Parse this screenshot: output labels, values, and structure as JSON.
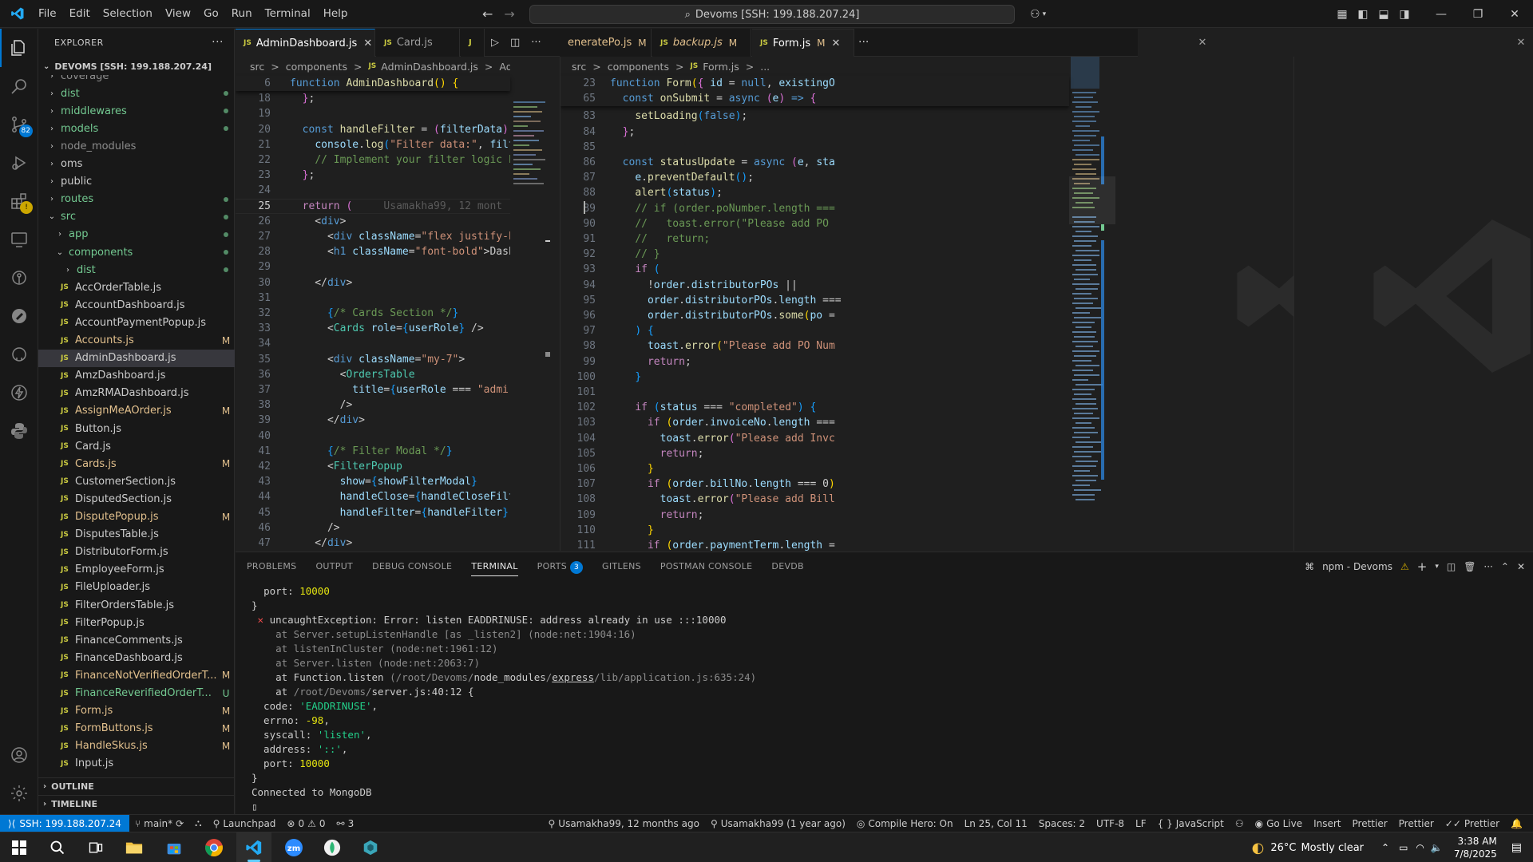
{
  "menu": [
    "File",
    "Edit",
    "Selection",
    "View",
    "Go",
    "Run",
    "Terminal",
    "Help"
  ],
  "command_center": "Devoms [SSH: 199.188.207.24]",
  "explorer": {
    "title": "EXPLORER",
    "workspace": "DEVOMS [SSH: 199.188.207.24]",
    "items": [
      {
        "name": "coverage",
        "kind": "folder",
        "depth": 1,
        "status": "",
        "color": "dim"
      },
      {
        "name": "dist",
        "kind": "folder",
        "depth": 1,
        "status": "dot",
        "color": "git"
      },
      {
        "name": "middlewares",
        "kind": "folder",
        "depth": 1,
        "status": "dot",
        "color": "git"
      },
      {
        "name": "models",
        "kind": "folder",
        "depth": 1,
        "status": "dot",
        "color": "git"
      },
      {
        "name": "node_modules",
        "kind": "folder",
        "depth": 1,
        "status": "",
        "color": "dim"
      },
      {
        "name": "oms",
        "kind": "folder",
        "depth": 1,
        "status": "",
        "color": "norm"
      },
      {
        "name": "public",
        "kind": "folder",
        "depth": 1,
        "status": "",
        "color": "norm"
      },
      {
        "name": "routes",
        "kind": "folder",
        "depth": 1,
        "status": "dot",
        "color": "git"
      },
      {
        "name": "src",
        "kind": "folder-open",
        "depth": 1,
        "status": "dot",
        "color": "git"
      },
      {
        "name": "app",
        "kind": "folder",
        "depth": 2,
        "status": "dot",
        "color": "git"
      },
      {
        "name": "components",
        "kind": "folder-open",
        "depth": 2,
        "status": "dot",
        "color": "git"
      },
      {
        "name": "dist",
        "kind": "folder",
        "depth": 3,
        "status": "dot",
        "color": "git"
      },
      {
        "name": "AccOrderTable.js",
        "kind": "js",
        "depth": 3,
        "status": "",
        "color": "norm"
      },
      {
        "name": "AccountDashboard.js",
        "kind": "js",
        "depth": 3,
        "status": "",
        "color": "norm"
      },
      {
        "name": "AccountPaymentPopup.js",
        "kind": "js",
        "depth": 3,
        "status": "",
        "color": "norm"
      },
      {
        "name": "Accounts.js",
        "kind": "js",
        "depth": 3,
        "status": "M",
        "color": "mod"
      },
      {
        "name": "AdminDashboard.js",
        "kind": "js",
        "depth": 3,
        "status": "",
        "color": "norm",
        "selected": true
      },
      {
        "name": "AmzDashboard.js",
        "kind": "js",
        "depth": 3,
        "status": "",
        "color": "norm"
      },
      {
        "name": "AmzRMADashboard.js",
        "kind": "js",
        "depth": 3,
        "status": "",
        "color": "norm"
      },
      {
        "name": "AssignMeAOrder.js",
        "kind": "js",
        "depth": 3,
        "status": "M",
        "color": "mod"
      },
      {
        "name": "Button.js",
        "kind": "js",
        "depth": 3,
        "status": "",
        "color": "norm"
      },
      {
        "name": "Card.js",
        "kind": "js",
        "depth": 3,
        "status": "",
        "color": "norm"
      },
      {
        "name": "Cards.js",
        "kind": "js",
        "depth": 3,
        "status": "M",
        "color": "mod"
      },
      {
        "name": "CustomerSection.js",
        "kind": "js",
        "depth": 3,
        "status": "",
        "color": "norm"
      },
      {
        "name": "DisputedSection.js",
        "kind": "js",
        "depth": 3,
        "status": "",
        "color": "norm"
      },
      {
        "name": "DisputePopup.js",
        "kind": "js",
        "depth": 3,
        "status": "M",
        "color": "mod"
      },
      {
        "name": "DisputesTable.js",
        "kind": "js",
        "depth": 3,
        "status": "",
        "color": "norm"
      },
      {
        "name": "DistributorForm.js",
        "kind": "js",
        "depth": 3,
        "status": "",
        "color": "norm"
      },
      {
        "name": "EmployeeForm.js",
        "kind": "js",
        "depth": 3,
        "status": "",
        "color": "norm"
      },
      {
        "name": "FileUploader.js",
        "kind": "js",
        "depth": 3,
        "status": "",
        "color": "norm"
      },
      {
        "name": "FilterOrdersTable.js",
        "kind": "js",
        "depth": 3,
        "status": "",
        "color": "norm"
      },
      {
        "name": "FilterPopup.js",
        "kind": "js",
        "depth": 3,
        "status": "",
        "color": "norm"
      },
      {
        "name": "FinanceComments.js",
        "kind": "js",
        "depth": 3,
        "status": "",
        "color": "norm"
      },
      {
        "name": "FinanceDashboard.js",
        "kind": "js",
        "depth": 3,
        "status": "",
        "color": "norm"
      },
      {
        "name": "FinanceNotVerifiedOrderT...",
        "kind": "js",
        "depth": 3,
        "status": "M",
        "color": "mod"
      },
      {
        "name": "FinanceReverifiedOrderTab...",
        "kind": "js",
        "depth": 3,
        "status": "U",
        "color": "unt"
      },
      {
        "name": "Form.js",
        "kind": "js",
        "depth": 3,
        "status": "M",
        "color": "mod"
      },
      {
        "name": "FormButtons.js",
        "kind": "js",
        "depth": 3,
        "status": "M",
        "color": "mod"
      },
      {
        "name": "HandleSkus.js",
        "kind": "js",
        "depth": 3,
        "status": "M",
        "color": "mod"
      },
      {
        "name": "Input.js",
        "kind": "js",
        "depth": 3,
        "status": "",
        "color": "norm"
      }
    ],
    "outline": "OUTLINE",
    "timeline": "TIMELINE"
  },
  "tabs_left": [
    {
      "name": "AdminDashboard.js",
      "active": true,
      "flag": "",
      "close": "✕"
    },
    {
      "name": "Card.js",
      "active": false,
      "flag": "",
      "close": ""
    },
    {
      "name": "J",
      "active": false,
      "flag": "",
      "close": ""
    }
  ],
  "tabs_right": [
    {
      "name": "eneratePo.js",
      "flag": "M",
      "italic": false
    },
    {
      "name": "backup.js",
      "flag": "M",
      "italic": true
    },
    {
      "name": "Form.js",
      "flag": "M",
      "italic": false,
      "close": "✕"
    }
  ],
  "left_pane": {
    "crumbs": [
      "src",
      ">",
      "components",
      ">",
      "JS",
      "AdminDashboard.js",
      ">",
      "AdminDashboarc"
    ],
    "sticky_ln": "6",
    "lines": [
      {
        "n": "18",
        "html": "  <span class='brc2'>}</span>;"
      },
      {
        "n": "19",
        "html": ""
      },
      {
        "n": "20",
        "html": "  <span class='kw'>const</span> <span class='fn'>handleFilter</span> = <span class='brc2'>(</span><span class='var'>filterData</span><span class='brc2'>)</span>"
      },
      {
        "n": "21",
        "html": "    <span class='var'>console</span>.<span class='fn'>log</span><span class='brc3'>(</span><span class='str'>\"Filter data:\"</span>, <span class='var'>filt</span>"
      },
      {
        "n": "22",
        "html": "    <span class='cm'>// Implement your filter logic h</span>"
      },
      {
        "n": "23",
        "html": "  <span class='brc2'>}</span>;"
      },
      {
        "n": "24",
        "html": ""
      },
      {
        "n": "25",
        "html": "  <span class='kw2'>return</span> <span class='brc2'>(</span>     <span class='blame'>Usamakha99, 12 mont</span>",
        "cur": true
      },
      {
        "n": "26",
        "html": "    &lt;<span class='tag'>div</span>&gt;"
      },
      {
        "n": "27",
        "html": "      &lt;<span class='tag'>div</span> <span class='attr'>className</span>=<span class='str'>\"flex justify-b</span>"
      },
      {
        "n": "28",
        "html": "      &lt;<span class='tag'>h1</span> <span class='attr'>className</span>=<span class='str'>\"font-bold\"</span>&gt;Dash"
      },
      {
        "n": "29",
        "html": ""
      },
      {
        "n": "30",
        "html": "    &lt;/<span class='tag'>div</span>&gt;"
      },
      {
        "n": "31",
        "html": ""
      },
      {
        "n": "32",
        "html": "      <span class='brc3'>{</span><span class='cm'>/* Cards Section */</span><span class='brc3'>}</span>"
      },
      {
        "n": "33",
        "html": "      &lt;<span class='cmp'>Cards</span> <span class='attr'>role</span>=<span class='brc3'>{</span><span class='var'>userRole</span><span class='brc3'>}</span> /&gt;"
      },
      {
        "n": "34",
        "html": ""
      },
      {
        "n": "35",
        "html": "      &lt;<span class='tag'>div</span> <span class='attr'>className</span>=<span class='str'>\"my-7\"</span>&gt;"
      },
      {
        "n": "36",
        "html": "        &lt;<span class='cmp'>OrdersTable</span>"
      },
      {
        "n": "37",
        "html": "          <span class='attr'>title</span>=<span class='brc3'>{</span><span class='var'>userRole</span> === <span class='str'>\"admir</span>"
      },
      {
        "n": "38",
        "html": "        /&gt;"
      },
      {
        "n": "39",
        "html": "      &lt;/<span class='tag'>div</span>&gt;"
      },
      {
        "n": "40",
        "html": ""
      },
      {
        "n": "41",
        "html": "      <span class='brc3'>{</span><span class='cm'>/* Filter Modal */</span><span class='brc3'>}</span>"
      },
      {
        "n": "42",
        "html": "      &lt;<span class='cmp'>FilterPopup</span>"
      },
      {
        "n": "43",
        "html": "        <span class='attr'>show</span>=<span class='brc3'>{</span><span class='var'>showFilterModal</span><span class='brc3'>}</span>"
      },
      {
        "n": "44",
        "html": "        <span class='attr'>handleClose</span>=<span class='brc3'>{</span><span class='var'>handleCloseFilt</span>"
      },
      {
        "n": "45",
        "html": "        <span class='attr'>handleFilter</span>=<span class='brc3'>{</span><span class='var'>handleFilter</span><span class='brc3'>}</span>"
      },
      {
        "n": "46",
        "html": "      /&gt;"
      },
      {
        "n": "47",
        "html": "    &lt;/<span class='tag'>div</span>&gt;"
      }
    ]
  },
  "right_pane": {
    "crumbs": [
      "src",
      ">",
      "components",
      ">",
      "JS",
      "Form.js",
      ">",
      "..."
    ],
    "sticky": [
      {
        "n": "23",
        "html": "<span class='kw'>function</span> <span class='fn'>Form</span><span class='brc'>(</span><span class='brc2'>{</span> <span class='var'>id</span> = <span class='kw'>null</span>, <span class='var'>existingO</span>"
      },
      {
        "n": "65",
        "html": "  <span class='kw'>const</span> <span class='fn'>onSubmit</span> = <span class='kw'>async</span> <span class='brc2'>(</span><span class='var'>e</span><span class='brc2'>)</span> <span class='kw'>=&gt;</span> <span class='brc2'>{</span>"
      }
    ],
    "lines": [
      {
        "n": "83",
        "html": "    <span class='fn'>setLoading</span><span class='brc3'>(</span><span class='kw'>false</span><span class='brc3'>)</span>;"
      },
      {
        "n": "84",
        "html": "  <span class='brc2'>}</span>;"
      },
      {
        "n": "85",
        "html": ""
      },
      {
        "n": "86",
        "html": "  <span class='kw'>const</span> <span class='fn'>statusUpdate</span> = <span class='kw'>async</span> <span class='brc2'>(</span><span class='var'>e</span>, <span class='var'>sta</span>"
      },
      {
        "n": "87",
        "html": "    <span class='var'>e</span>.<span class='fn'>preventDefault</span><span class='brc3'>()</span>;"
      },
      {
        "n": "88",
        "html": "    <span class='fn'>alert</span><span class='brc3'>(</span><span class='var'>status</span><span class='brc3'>)</span>;"
      },
      {
        "n": "89",
        "html": "    <span class='cm'>// if (order.poNumber.length ===</span>"
      },
      {
        "n": "90",
        "html": "    <span class='cm'>//   toast.error(\"Please add PO</span>"
      },
      {
        "n": "91",
        "html": "    <span class='cm'>//   return;</span>"
      },
      {
        "n": "92",
        "html": "    <span class='cm'>// }</span>"
      },
      {
        "n": "93",
        "html": "    <span class='kw2'>if</span> <span class='brc3'>(</span>"
      },
      {
        "n": "94",
        "html": "      !<span class='var'>order</span>.<span class='var'>distributorPOs</span> ||"
      },
      {
        "n": "95",
        "html": "      <span class='var'>order</span>.<span class='var'>distributorPOs</span>.<span class='var'>length</span> ==="
      },
      {
        "n": "96",
        "html": "      <span class='var'>order</span>.<span class='var'>distributorPOs</span>.<span class='fn'>some</span><span class='brc'>(</span><span class='var'>po</span> ="
      },
      {
        "n": "97",
        "html": "    <span class='brc3'>)</span> <span class='brc3'>{</span>"
      },
      {
        "n": "98",
        "html": "      <span class='var'>toast</span>.<span class='fn'>error</span><span class='brc'>(</span><span class='str'>\"Please add PO Num</span>"
      },
      {
        "n": "99",
        "html": "      <span class='kw2'>return</span>;"
      },
      {
        "n": "100",
        "html": "    <span class='brc3'>}</span>"
      },
      {
        "n": "101",
        "html": ""
      },
      {
        "n": "102",
        "html": "    <span class='kw2'>if</span> <span class='brc3'>(</span><span class='var'>status</span> === <span class='str'>\"completed\"</span><span class='brc3'>)</span> <span class='brc3'>{</span>"
      },
      {
        "n": "103",
        "html": "      <span class='kw2'>if</span> <span class='brc'>(</span><span class='var'>order</span>.<span class='var'>invoiceNo</span>.<span class='var'>length</span> ==="
      },
      {
        "n": "104",
        "html": "        <span class='var'>toast</span>.<span class='fn'>error</span><span class='brc2'>(</span><span class='str'>\"Please add Invc</span>"
      },
      {
        "n": "105",
        "html": "        <span class='kw2'>return</span>;"
      },
      {
        "n": "106",
        "html": "      <span class='brc'>}</span>"
      },
      {
        "n": "107",
        "html": "      <span class='kw2'>if</span> <span class='brc'>(</span><span class='var'>order</span>.<span class='var'>billNo</span>.<span class='var'>length</span> === <span class='num'>0</span><span class='brc'>)</span>"
      },
      {
        "n": "108",
        "html": "        <span class='var'>toast</span>.<span class='fn'>error</span><span class='brc2'>(</span><span class='str'>\"Please add Bill</span>"
      },
      {
        "n": "109",
        "html": "        <span class='kw2'>return</span>;"
      },
      {
        "n": "110",
        "html": "      <span class='brc'>}</span>"
      },
      {
        "n": "111",
        "html": "      <span class='kw2'>if</span> <span class='brc'>(</span><span class='var'>order</span>.<span class='var'>paymentTerm</span>.<span class='var'>length</span> ="
      }
    ]
  },
  "panel": {
    "tabs": [
      "PROBLEMS",
      "OUTPUT",
      "DEBUG CONSOLE",
      "TERMINAL",
      "PORTS",
      "GITLENS",
      "POSTMAN CONSOLE",
      "DEVDB"
    ],
    "active_tab": "TERMINAL",
    "ports_badge": "3",
    "terminal_name": "npm - Devoms",
    "terminal_lines": [
      {
        "html": "  <span class='c-norm'>port</span>: <span class='t-num'>10000</span>"
      },
      {
        "html": "}"
      },
      {
        "html": " <span class='t-err'>✕</span> uncaughtException: Error: listen EADDRINUSE: address already in use :::10000"
      },
      {
        "html": "    <span class='t-dim'>at Server.setupListenHandle [as _listen2] (node:net:1904:16)</span>"
      },
      {
        "html": "    <span class='t-dim'>at listenInCluster (node:net:1961:12)</span>"
      },
      {
        "html": "    <span class='t-dim'>at Server.listen (node:net:2063:7)</span>"
      },
      {
        "html": "    at Function.listen <span class='t-dim'>(/root/Devoms/</span>node_modules<span class='t-dim'>/</span><u>express</u><span class='t-dim'>/lib/application.js:635:24)</span>"
      },
      {
        "html": "    at <span class='t-dim'>/root/Devoms/</span>server.js:40:12 {"
      },
      {
        "html": "  code: <span class='t-str'>'EADDRINUSE'</span>,"
      },
      {
        "html": "  errno: <span class='t-num'>-98</span>,"
      },
      {
        "html": "  syscall: <span class='t-str'>'listen'</span>,"
      },
      {
        "html": "  address: <span class='t-str'>'::'</span>,"
      },
      {
        "html": "  port: <span class='t-num'>10000</span>"
      },
      {
        "html": "}"
      },
      {
        "html": "Connected to MongoDB"
      },
      {
        "html": "▯"
      }
    ]
  },
  "status": {
    "remote": "SSH: 199.188.207.24",
    "branch": "main*",
    "launchpad": "Launchpad",
    "errors": "0",
    "warnings": "0",
    "ports": "3",
    "blame": "Usamakha99, 12 months ago",
    "author": "Usamakha99 (1 year ago)",
    "compile": "Compile Hero: On",
    "position": "Ln 25, Col 11",
    "spaces": "Spaces: 2",
    "encoding": "UTF-8",
    "eol": "LF",
    "language": "JavaScript",
    "golive": "Go Live",
    "insert": "Insert",
    "prettier1": "Prettier",
    "prettier2": "Prettier",
    "prettier3": "Prettier"
  },
  "taskbar": {
    "weather": "26°C",
    "weather_text": "Mostly clear",
    "time": "3:38 AM",
    "date": "7/8/2025"
  },
  "colors": {
    "accent": "#0078d4",
    "modified": "#e2c08d",
    "untracked": "#73c991"
  }
}
